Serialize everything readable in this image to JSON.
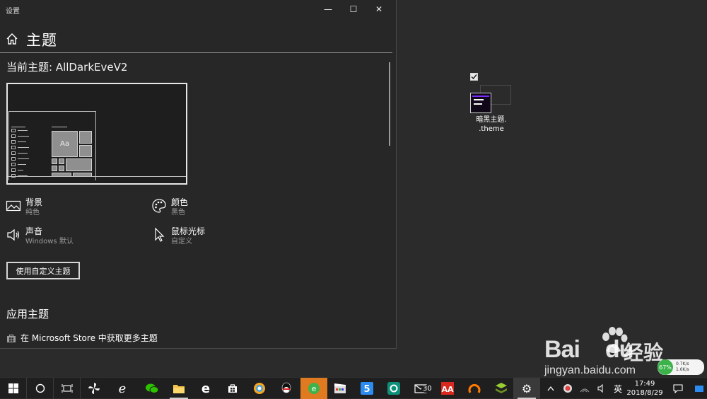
{
  "window": {
    "app_title": "设置",
    "minimize_glyph": "—",
    "maximize_glyph": "☐",
    "close_glyph": "✕",
    "page_title": "主题",
    "current_theme": "当前主题: AllDarkEveV2",
    "preview_tile_label": "Aa",
    "options": {
      "background": {
        "title": "背景",
        "value": "纯色",
        "icon": "picture-icon"
      },
      "color": {
        "title": "颜色",
        "value": "黑色",
        "icon": "palette-icon"
      },
      "sound": {
        "title": "声音",
        "value": "Windows 默认",
        "icon": "speaker-icon"
      },
      "cursor": {
        "title": "鼠标光标",
        "value": "自定义",
        "icon": "cursor-icon"
      }
    },
    "custom_theme_button": "使用自定义主题",
    "apply_heading": "应用主题",
    "store_link": "在 Microsoft Store 中获取更多主题"
  },
  "desktop": {
    "file_name_line1": "暗黑主题.",
    "file_name_line2": ".theme"
  },
  "watermark": {
    "brand": "Bai",
    "brand_suffix": "du",
    "brand_cn": "经验",
    "url": "jingyan.baidu.com"
  },
  "net_widget": {
    "percent": "67%",
    "up": "0.7K/s",
    "down": "1.6K/s"
  },
  "taskbar": {
    "mail_badge": "30",
    "ime": "英",
    "time": "17:49",
    "date": "2018/8/29"
  },
  "colors": {
    "window_bg": "#272727",
    "desktop_bg": "#2b2b2b",
    "taskbar_bg": "#1f1f1f",
    "active_app": "#e07a21"
  }
}
